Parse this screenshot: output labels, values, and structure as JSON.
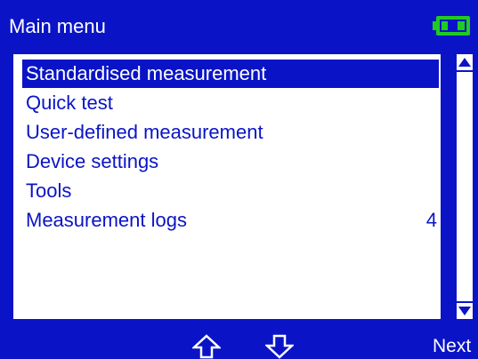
{
  "header": {
    "title": "Main menu",
    "battery_icon": "battery-icon",
    "colors": {
      "background": "#0a14c6",
      "text": "#ffffff",
      "battery": "#1fcc1f"
    }
  },
  "menu": {
    "items": [
      {
        "label": "Standardised measurement",
        "count": "",
        "selected": true
      },
      {
        "label": "Quick test",
        "count": "",
        "selected": false
      },
      {
        "label": "User-defined measurement",
        "count": "",
        "selected": false
      },
      {
        "label": "Device settings",
        "count": "",
        "selected": false
      },
      {
        "label": "Tools",
        "count": "",
        "selected": false
      },
      {
        "label": "Measurement logs",
        "count": "4",
        "selected": false
      }
    ]
  },
  "scrollbar": {
    "up_icon": "scroll-up-arrow-icon",
    "down_icon": "scroll-down-arrow-icon"
  },
  "softkeys": {
    "up_icon": "up-arrow-icon",
    "down_icon": "down-arrow-icon",
    "next_label": "Next"
  }
}
